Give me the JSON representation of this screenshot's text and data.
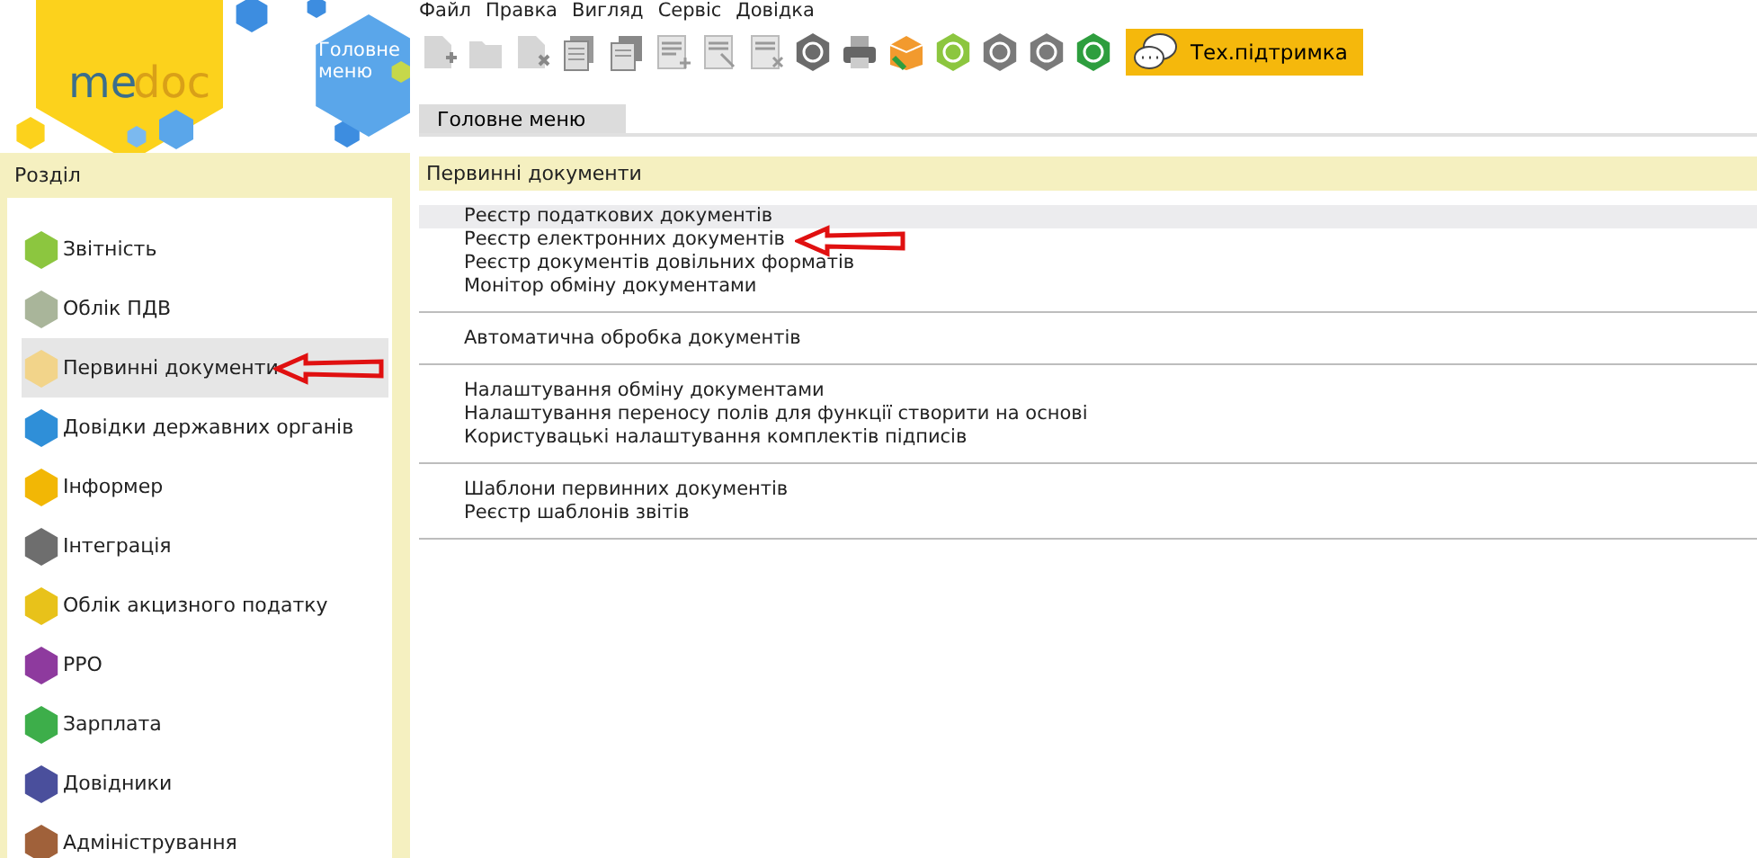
{
  "logo": {
    "text_1": "me",
    "text_2": "doc"
  },
  "home_button": {
    "label": "Головне меню"
  },
  "menu": [
    "Файл",
    "Правка",
    "Вигляд",
    "Сервіс",
    "Довідка"
  ],
  "toolbar": [
    {
      "kind": "doc-add"
    },
    {
      "kind": "folder"
    },
    {
      "kind": "doc-delete"
    },
    {
      "kind": "copy"
    },
    {
      "kind": "copy2"
    },
    {
      "kind": "list-add"
    },
    {
      "kind": "list-edit"
    },
    {
      "kind": "list-delete"
    },
    {
      "kind": "hex"
    },
    {
      "kind": "printer"
    },
    {
      "kind": "box"
    },
    {
      "kind": "hex"
    },
    {
      "kind": "hex"
    },
    {
      "kind": "hex"
    },
    {
      "kind": "hex"
    }
  ],
  "support_button": {
    "label": "Тех.підтримка"
  },
  "tabs": [
    {
      "label": "Головне меню",
      "selected": true
    }
  ],
  "sidebar": {
    "title": "Розділ",
    "items": [
      {
        "label": "Звітність",
        "color": "#8cc63f",
        "selected": false,
        "arrow": false
      },
      {
        "label": "Облік ПДВ",
        "color": "#a9b59a",
        "selected": false,
        "arrow": false
      },
      {
        "label": "Первинні документи",
        "color": "#f2d48a",
        "selected": true,
        "arrow": true
      },
      {
        "label": "Довідки державних органів",
        "color": "#2f8fd8",
        "selected": false,
        "arrow": false
      },
      {
        "label": "Інформер",
        "color": "#f2b705",
        "selected": false,
        "arrow": false
      },
      {
        "label": "Інтеграція",
        "color": "#6e6e6e",
        "selected": false,
        "arrow": false
      },
      {
        "label": "Облік акцизного податку",
        "color": "#e8c21a",
        "selected": false,
        "arrow": false
      },
      {
        "label": "РРО",
        "color": "#8e3a9e",
        "selected": false,
        "arrow": false
      },
      {
        "label": "Зарплата",
        "color": "#3dae4a",
        "selected": false,
        "arrow": false
      },
      {
        "label": "Довідники",
        "color": "#4a4f9c",
        "selected": false,
        "arrow": false
      },
      {
        "label": "Адміністрування",
        "color": "#a0613a",
        "selected": false,
        "arrow": false
      }
    ]
  },
  "section": {
    "title": "Первинні документи",
    "groups": [
      [
        {
          "label": "Реєстр податкових документів",
          "highlighted": true,
          "arrow": false
        },
        {
          "label": "Реєстр електронних документів",
          "highlighted": false,
          "arrow": true
        },
        {
          "label": "Реєстр документів довільних форматів",
          "highlighted": false,
          "arrow": false
        },
        {
          "label": "Монітор обміну документами",
          "highlighted": false,
          "arrow": false
        }
      ],
      [
        {
          "label": "Автоматична обробка документів",
          "highlighted": false,
          "arrow": false
        }
      ],
      [
        {
          "label": "Налаштування обміну документами",
          "highlighted": false,
          "arrow": false
        },
        {
          "label": "Налаштування переносу полів для функції створити на основі",
          "highlighted": false,
          "arrow": false
        },
        {
          "label": "Користувацькі налаштування комплектів підписів",
          "highlighted": false,
          "arrow": false
        }
      ],
      [
        {
          "label": "Шаблони первинних документів",
          "highlighted": false,
          "arrow": false
        },
        {
          "label": "Реєстр шаблонів звітів",
          "highlighted": false,
          "arrow": false
        }
      ]
    ]
  }
}
